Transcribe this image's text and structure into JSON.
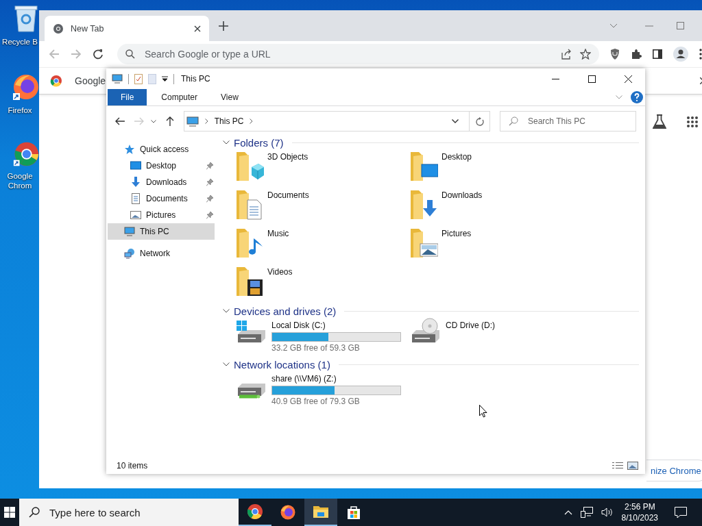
{
  "desktop_icons": [
    {
      "label": "Recycle B",
      "kind": "recycle_bin"
    },
    {
      "label": "Firefox",
      "kind": "firefox"
    },
    {
      "label": "Google Chrom",
      "kind": "chrome"
    }
  ],
  "browser": {
    "tabs": [
      {
        "title": "New Tab",
        "selected": true
      }
    ],
    "address_bar": {
      "placeholder": "Search Google or type a URL"
    },
    "shortcut": "Google",
    "customize_button": "nize Chrome"
  },
  "explorer": {
    "title": "This PC",
    "ribbon_tabs": [
      {
        "label": "File",
        "selected": true
      },
      {
        "label": "Computer",
        "selected": false
      },
      {
        "label": "View",
        "selected": false
      }
    ],
    "address": "This PC",
    "search": {
      "placeholder": "Search This PC"
    },
    "nav": [
      {
        "label": "Quick access",
        "kind": "quick",
        "selected": false,
        "children": [
          {
            "label": "Desktop",
            "kind": "desktop",
            "pinned": true,
            "selected": false
          },
          {
            "label": "Downloads",
            "kind": "downloads",
            "pinned": true,
            "selected": false
          },
          {
            "label": "Documents",
            "kind": "documents",
            "pinned": true,
            "selected": false
          },
          {
            "label": "Pictures",
            "kind": "pictures",
            "pinned": true,
            "selected": false
          }
        ]
      },
      {
        "label": "This PC",
        "kind": "pc",
        "selected": true
      },
      {
        "label": "Network",
        "kind": "network",
        "selected": false
      }
    ],
    "sections": [
      {
        "title": "Folders (7)",
        "items": [
          {
            "name": "3D Objects",
            "kind": "cube"
          },
          {
            "name": "Desktop",
            "kind": "desktop"
          },
          {
            "name": "Documents",
            "kind": "documents"
          },
          {
            "name": "Downloads",
            "kind": "downloads"
          },
          {
            "name": "Music",
            "kind": "music"
          },
          {
            "name": "Pictures",
            "kind": "pictures"
          },
          {
            "name": "Videos",
            "kind": "videos"
          }
        ]
      },
      {
        "title": "Devices and drives (2)",
        "items": [
          {
            "name": "Local Disk (C:)",
            "kind": "disk",
            "level": 0.44,
            "detail": "33.2 GB free of 59.3 GB"
          },
          {
            "name": "CD Drive (D:)",
            "kind": "cd"
          }
        ]
      },
      {
        "title": "Network locations (1)",
        "items": [
          {
            "name": "share (\\\\VM6) (Z:)",
            "kind": "netdrive",
            "level": 0.484,
            "detail": "40.9 GB free of 79.3 GB"
          }
        ]
      }
    ],
    "status": "10 items"
  },
  "taskbar": {
    "search_placeholder": "Type here to search",
    "apps": [
      {
        "kind": "chrome",
        "running": true,
        "selected": false
      },
      {
        "kind": "firefox",
        "running": false,
        "selected": false
      },
      {
        "kind": "explorer",
        "running": true,
        "selected": true
      },
      {
        "kind": "store",
        "running": false,
        "selected": false
      }
    ],
    "time": "2:56 PM",
    "date": "8/10/2023"
  }
}
